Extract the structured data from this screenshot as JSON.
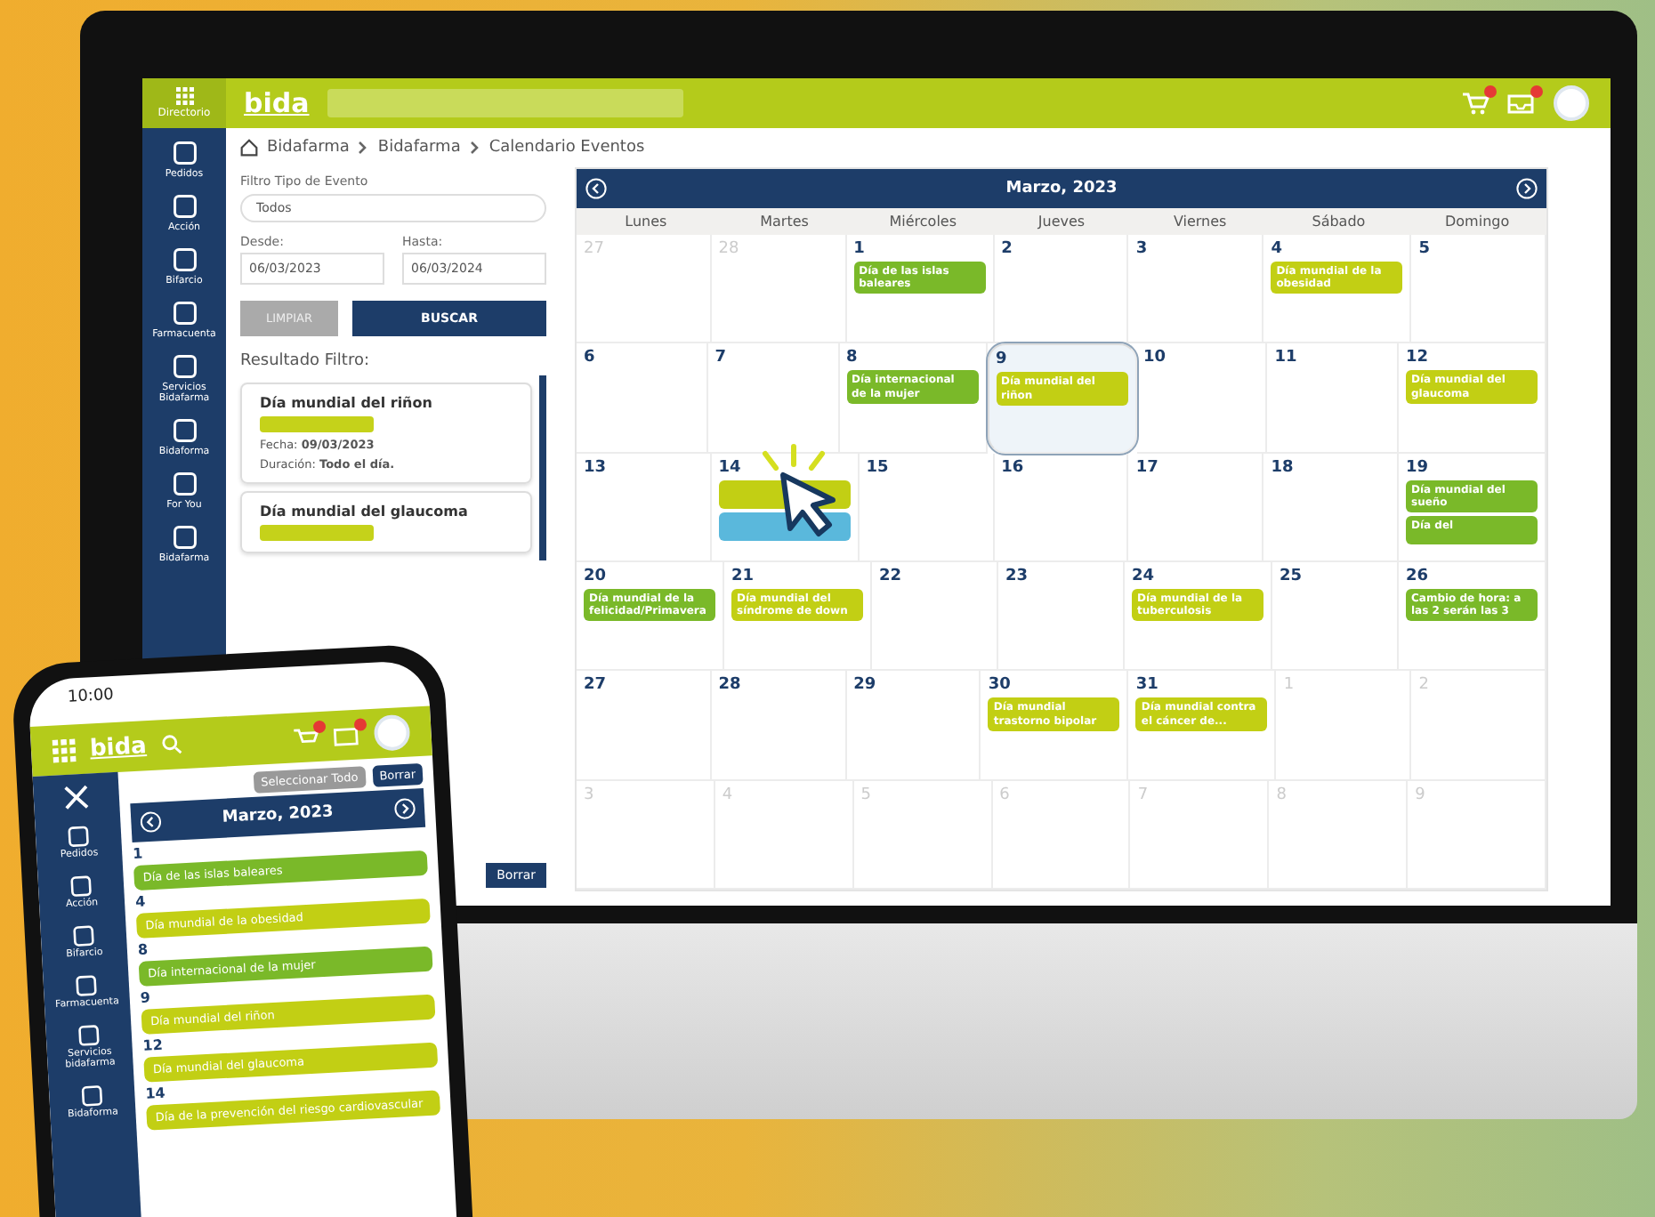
{
  "desktop": {
    "logo": "bida",
    "topbar_label": "Directorio",
    "sidebar": [
      {
        "label": "Pedidos"
      },
      {
        "label": "Acción"
      },
      {
        "label": "Bifarcio"
      },
      {
        "label": "Farmacuenta"
      },
      {
        "label": "Servicios Bidafarma"
      },
      {
        "label": "Bidaforma"
      },
      {
        "label": "For You"
      },
      {
        "label": "Bidafarma"
      }
    ],
    "breadcrumb": [
      "Bidafarma",
      "Bidafarma",
      "Calendario Eventos"
    ],
    "filter": {
      "type_label": "Filtro Tipo de Evento",
      "type_value": "Todos",
      "from_label": "Desde:",
      "from_value": "06/03/2023",
      "to_label": "Hasta:",
      "to_value": "06/03/2024",
      "clear_button": "LIMPIAR",
      "search_button": "BUSCAR",
      "results_label": "Resultado Filtro:"
    },
    "results": [
      {
        "title": "Día mundial del riñon",
        "lines": [
          {
            "label": "Fecha:",
            "value": "09/03/2023"
          },
          {
            "label": "Duración:",
            "value": "Todo el día."
          }
        ]
      },
      {
        "title": "Día mundial del glaucoma"
      }
    ],
    "bottom_buttons": [
      "Borrar"
    ],
    "calendar": {
      "title": "Marzo, 2023",
      "weekdays": [
        "Lunes",
        "Martes",
        "Miércoles",
        "Jueves",
        "Viernes",
        "Sábado",
        "Domingo"
      ],
      "weeks": [
        [
          {
            "day": "27",
            "other_month": true,
            "selected": false
          },
          {
            "day": "28",
            "other_month": true,
            "selected": false
          },
          {
            "day": "1",
            "other_month": false,
            "selected": false,
            "events": [
              {
                "label": "Día de las islas baleares",
                "color": "#7ab929"
              }
            ]
          },
          {
            "day": "2",
            "other_month": false,
            "selected": false
          },
          {
            "day": "3",
            "other_month": false,
            "selected": false
          },
          {
            "day": "4",
            "other_month": false,
            "selected": false,
            "events": [
              {
                "label": "Día mundial de la obesidad",
                "color": "#c2cf14"
              }
            ]
          },
          {
            "day": "5",
            "other_month": false,
            "selected": false
          }
        ],
        [
          {
            "day": "6",
            "other_month": false,
            "selected": false
          },
          {
            "day": "7",
            "other_month": false,
            "selected": false
          },
          {
            "day": "8",
            "other_month": false,
            "selected": false,
            "events": [
              {
                "label": "Día internacional de la mujer",
                "color": "#7ab929"
              }
            ]
          },
          {
            "day": "9",
            "other_month": false,
            "selected": true,
            "events": [
              {
                "label": "Día mundial del riñon",
                "color": "#c2cf14"
              }
            ]
          },
          {
            "day": "10",
            "other_month": false,
            "selected": false
          },
          {
            "day": "11",
            "other_month": false,
            "selected": false
          },
          {
            "day": "12",
            "other_month": false,
            "selected": false,
            "events": [
              {
                "label": "Día mundial del glaucoma",
                "color": "#c2cf14"
              }
            ]
          }
        ],
        [
          {
            "day": "13",
            "other_month": false,
            "selected": false
          },
          {
            "day": "14",
            "other_month": false,
            "selected": false,
            "cursor": true,
            "events": [
              {
                "color": "#c2cf14"
              },
              {
                "color": "#5ab8dc"
              }
            ]
          },
          {
            "day": "15",
            "other_month": false,
            "selected": false
          },
          {
            "day": "16",
            "other_month": false,
            "selected": false
          },
          {
            "day": "17",
            "other_month": false,
            "selected": false
          },
          {
            "day": "18",
            "other_month": false,
            "selected": false
          },
          {
            "day": "19",
            "other_month": false,
            "selected": false,
            "events": [
              {
                "label": "Día mundial del sueño",
                "color": "#7ab929"
              },
              {
                "label": "Día del",
                "color": "#7ab929"
              }
            ]
          }
        ],
        [
          {
            "day": "20",
            "other_month": false,
            "selected": false,
            "events": [
              {
                "label": "Día mundial de la felicidad/Primavera",
                "color": "#7ab929"
              }
            ]
          },
          {
            "day": "21",
            "other_month": false,
            "selected": false,
            "events": [
              {
                "label": "Día mundial del síndrome de down",
                "color": "#c2cf14"
              }
            ]
          },
          {
            "day": "22",
            "other_month": false,
            "selected": false
          },
          {
            "day": "23",
            "other_month": false,
            "selected": false
          },
          {
            "day": "24",
            "other_month": false,
            "selected": false,
            "events": [
              {
                "label": "Día mundial de la tuberculosis",
                "color": "#c2cf14"
              }
            ]
          },
          {
            "day": "25",
            "other_month": false,
            "selected": false
          },
          {
            "day": "26",
            "other_month": false,
            "selected": false,
            "events": [
              {
                "label": "Cambio de hora: a las 2 serán las 3",
                "color": "#7ab929"
              }
            ]
          }
        ],
        [
          {
            "day": "27",
            "other_month": false,
            "selected": false
          },
          {
            "day": "28",
            "other_month": false,
            "selected": false
          },
          {
            "day": "29",
            "other_month": false,
            "selected": false
          },
          {
            "day": "30",
            "other_month": false,
            "selected": false,
            "events": [
              {
                "label": "Día mundial trastorno bipolar",
                "color": "#c2cf14"
              }
            ]
          },
          {
            "day": "31",
            "other_month": false,
            "selected": false,
            "events": [
              {
                "label": "Día mundial contra el cáncer de...",
                "color": "#c2cf14"
              }
            ]
          },
          {
            "day": "1",
            "other_month": true,
            "selected": false
          },
          {
            "day": "2",
            "other_month": true,
            "selected": false
          }
        ],
        [
          {
            "day": "3",
            "other_month": true,
            "selected": false
          },
          {
            "day": "4",
            "other_month": true,
            "selected": false
          },
          {
            "day": "5",
            "other_month": true,
            "selected": false
          },
          {
            "day": "6",
            "other_month": true,
            "selected": false
          },
          {
            "day": "7",
            "other_month": true,
            "selected": false
          },
          {
            "day": "8",
            "other_month": true,
            "selected": false
          },
          {
            "day": "9",
            "other_month": true,
            "selected": false
          }
        ]
      ]
    }
  },
  "phone": {
    "time": "10:00",
    "logo": "bida",
    "buttons": [
      {
        "label": "Seleccionar Todo",
        "kind": "grey"
      },
      {
        "label": "Borrar",
        "kind": "navy"
      }
    ],
    "menu": [
      {
        "label": "Pedidos"
      },
      {
        "label": "Acción"
      },
      {
        "label": "Bifarcio"
      },
      {
        "label": "Farmacuenta"
      },
      {
        "label": "Servicios bidafarma"
      },
      {
        "label": "Bidaforma"
      }
    ],
    "calendar_title": "Marzo, 2023",
    "days": [
      {
        "day": "1",
        "events": [
          {
            "label": "Día de las islas baleares",
            "color": "#7ab929"
          }
        ]
      },
      {
        "day": "4",
        "events": [
          {
            "label": "Día mundial de la obesidad",
            "color": "#c2cf14"
          }
        ]
      },
      {
        "day": "8",
        "events": [
          {
            "label": "Día internacional de la mujer",
            "color": "#7ab929"
          }
        ]
      },
      {
        "day": "9",
        "events": [
          {
            "label": "Día mundial del riñon",
            "color": "#c2cf14"
          }
        ]
      },
      {
        "day": "12",
        "events": [
          {
            "label": "Día mundial del glaucoma",
            "color": "#c2cf14"
          }
        ]
      },
      {
        "day": "14",
        "events": [
          {
            "label": "Día de la prevención del riesgo cardiovascular",
            "color": "#c2cf14"
          }
        ]
      }
    ]
  }
}
